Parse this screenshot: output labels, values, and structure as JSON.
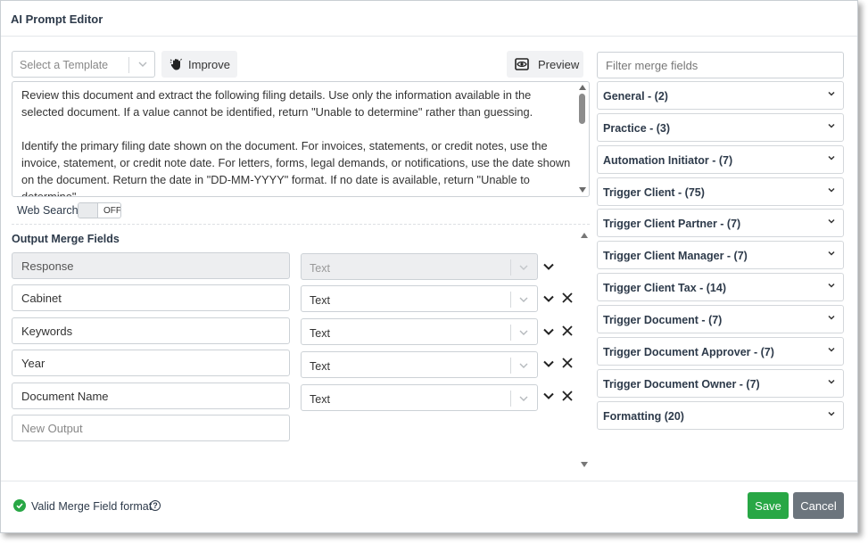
{
  "dialog": {
    "title": "AI Prompt Editor"
  },
  "toolbar": {
    "template_placeholder": "Select a Template",
    "improve_label": "Improve",
    "preview_label": "Preview"
  },
  "prompt": {
    "paragraph_1": "Review this document and extract the following filing details. Use only the information available in the selected document. If a value cannot be identified, return \"Unable to determine\" rather than guessing.",
    "paragraph_2": "Identify the primary filing date shown on the document. For invoices, statements, or credit notes, use the invoice, statement, or credit note date. For letters, forms, legal demands, or notifications, use the date shown on the document. Return the date in \"DD-MM-YYYY\" format. If no date is available, return \"Unable to determine\"."
  },
  "web_search": {
    "label": "Web Search",
    "state": "OFF"
  },
  "outputs": {
    "title": "Output Merge Fields",
    "rows": [
      {
        "name": "Response",
        "type": "Text",
        "disabled": true
      },
      {
        "name": "Cabinet",
        "type": "Text",
        "disabled": false
      },
      {
        "name": "Keywords",
        "type": "Text",
        "disabled": false
      },
      {
        "name": "Year",
        "type": "Text",
        "disabled": false
      },
      {
        "name": "Document Name",
        "type": "Text",
        "disabled": false
      }
    ],
    "new_placeholder": "New Output"
  },
  "merge_fields": {
    "filter_placeholder": "Filter merge fields",
    "groups": [
      {
        "label": "General - (2)"
      },
      {
        "label": "Practice - (3)"
      },
      {
        "label": "Automation Initiator - (7)"
      },
      {
        "label": "Trigger Client - (75)"
      },
      {
        "label": "Trigger Client Partner - (7)"
      },
      {
        "label": "Trigger Client Manager - (7)"
      },
      {
        "label": "Trigger Client Tax - (14)"
      },
      {
        "label": "Trigger Document - (7)"
      },
      {
        "label": "Trigger Document Approver - (7)"
      },
      {
        "label": "Trigger Document Owner - (7)"
      },
      {
        "label": "Formatting (20)"
      }
    ]
  },
  "footer": {
    "status": "Valid Merge Field format",
    "help": "?",
    "save_label": "Save",
    "cancel_label": "Cancel"
  },
  "colors": {
    "success": "#28a745",
    "secondary": "#6c757d",
    "heading": "#2d3a4a"
  },
  "icons": {
    "improve": "hand-sparkle-icon",
    "preview": "eye-icon",
    "chevron": "chevron-down-icon",
    "remove": "close-icon",
    "valid": "check-circle-icon",
    "help": "question-circle-icon"
  }
}
